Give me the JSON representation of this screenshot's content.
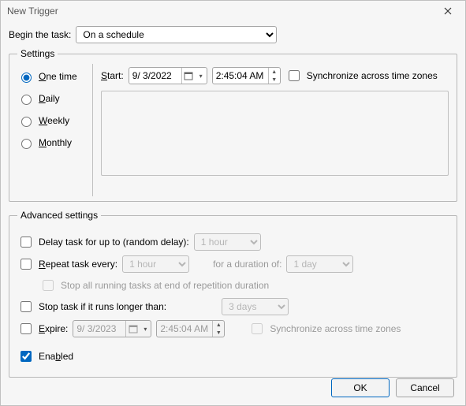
{
  "window": {
    "title": "New Trigger"
  },
  "beginTask": {
    "label": "Begin the task:",
    "value": "On a schedule"
  },
  "settings": {
    "legend": "Settings",
    "options": {
      "one_time": "One time",
      "daily": "Daily",
      "weekly": "Weekly",
      "monthly": "Monthly"
    },
    "start": {
      "label": "Start:",
      "date": "9/ 3/2022",
      "time": "2:45:04 AM"
    },
    "sync_tz": "Synchronize across time zones"
  },
  "advanced": {
    "legend": "Advanced settings",
    "delay": {
      "label": "Delay task for up to (random delay):",
      "value": "1 hour"
    },
    "repeat": {
      "label": "Repeat task every:",
      "value": "1 hour",
      "duration_label": "for a duration of:",
      "duration_value": "1 day",
      "stop_all": "Stop all running tasks at end of repetition duration"
    },
    "stop_if": {
      "label": "Stop task if it runs longer than:",
      "value": "3 days"
    },
    "expire": {
      "label": "Expire:",
      "date": "9/ 3/2023",
      "time": "2:45:04 AM",
      "sync_tz": "Synchronize across time zones"
    },
    "enabled": "Enabled"
  },
  "buttons": {
    "ok": "OK",
    "cancel": "Cancel"
  },
  "underline": {
    "O": "O",
    "ne_time": "ne time",
    "D": "D",
    "aily": "aily",
    "W": "W",
    "eekly": "eekly",
    "M": "M",
    "onthly": "onthly",
    "S": "S",
    "tart": "tart:",
    "R": "R",
    "epeat": "epeat task every:",
    "E": "E",
    "xpire": "xpire:",
    "Ena": "Ena",
    "b": "b",
    "led": "led"
  }
}
